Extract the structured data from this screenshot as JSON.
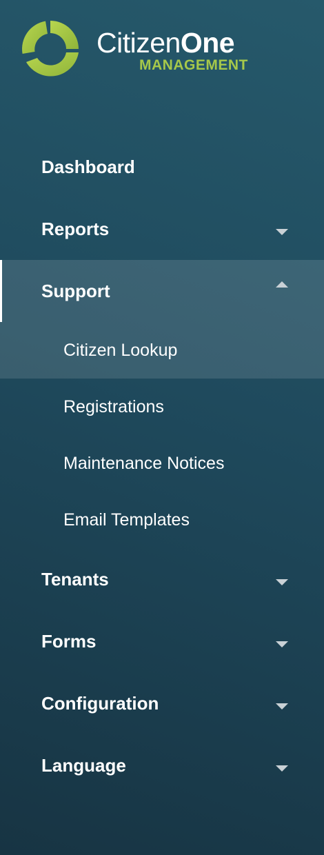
{
  "brand": {
    "name_light": "Citizen",
    "name_bold": "One",
    "subtitle": "MANAGEMENT",
    "colors": {
      "accent_green": "#a6c84a",
      "background": "#1f4a5d"
    },
    "mark_icon": "ring-logo-icon"
  },
  "nav": {
    "dashboard": {
      "label": "Dashboard"
    },
    "reports": {
      "label": "Reports",
      "icon": "caret-down-icon"
    },
    "support": {
      "label": "Support",
      "icon": "caret-up-icon",
      "expanded": true,
      "children": [
        {
          "label": "Citizen Lookup",
          "active": true
        },
        {
          "label": "Registrations"
        },
        {
          "label": "Maintenance Notices"
        },
        {
          "label": "Email Templates"
        }
      ]
    },
    "tenants": {
      "label": "Tenants",
      "icon": "caret-down-icon"
    },
    "forms": {
      "label": "Forms",
      "icon": "caret-down-icon"
    },
    "configuration": {
      "label": "Configuration",
      "icon": "caret-down-icon"
    },
    "language": {
      "label": "Language",
      "icon": "caret-down-icon"
    }
  }
}
